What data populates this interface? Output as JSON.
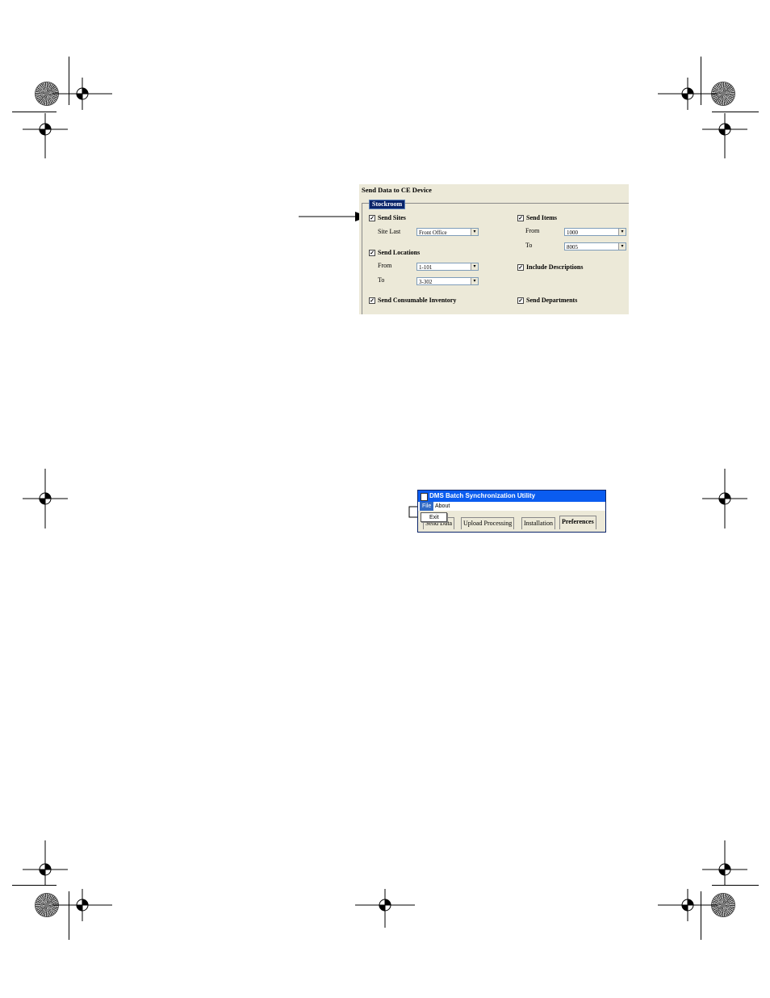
{
  "send_panel": {
    "title": "Send Data to CE Device",
    "group_title": "Stockroom",
    "send_sites": {
      "label": "Send Sites",
      "checked": true
    },
    "site_last": {
      "label": "Site Last",
      "value": "Front Office"
    },
    "send_locations": {
      "label": "Send Locations",
      "checked": true
    },
    "locations_from": {
      "label": "From",
      "value": "1-101"
    },
    "locations_to": {
      "label": "To",
      "value": "3-302"
    },
    "send_consumable": {
      "label": "Send Consumable Inventory",
      "checked": true
    },
    "send_items": {
      "label": "Send Items",
      "checked": true
    },
    "items_from": {
      "label": "From",
      "value": "1000"
    },
    "items_to": {
      "label": "To",
      "value": "8005"
    },
    "include_descriptions": {
      "label": "Include Descriptions",
      "checked": true
    },
    "send_departments": {
      "label": "Send Departments",
      "checked": true
    },
    "check_glyph": "✓",
    "arrow_glyph": "▾"
  },
  "dms_window": {
    "title": "DMS Batch Synchronization Utility",
    "menu": {
      "file": "File",
      "about": "About"
    },
    "file_dropdown_item": "Exit",
    "tabs": [
      "Send Data",
      "Upload Processing",
      "Installation",
      "Preferences"
    ],
    "active_tab": "Preferences"
  }
}
